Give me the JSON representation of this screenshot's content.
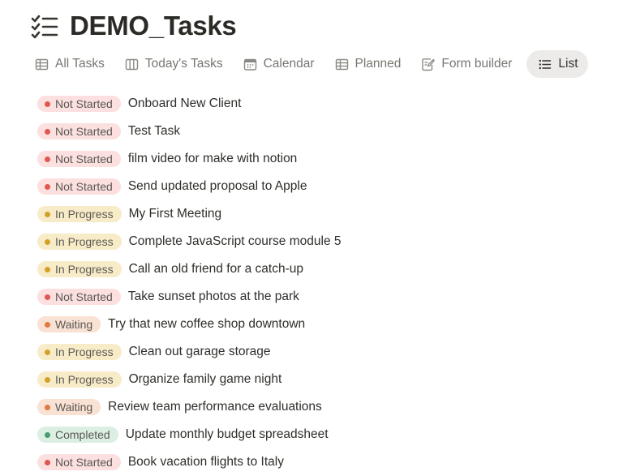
{
  "header": {
    "title": "DEMO_Tasks",
    "icon": "checklist-icon"
  },
  "tabs": [
    {
      "label": "All Tasks",
      "icon": "table-icon",
      "active": false
    },
    {
      "label": "Today's Tasks",
      "icon": "board-icon",
      "active": false
    },
    {
      "label": "Calendar",
      "icon": "calendar-icon",
      "active": false
    },
    {
      "label": "Planned",
      "icon": "table-icon",
      "active": false
    },
    {
      "label": "Form builder",
      "icon": "form-icon",
      "active": false
    },
    {
      "label": "List",
      "icon": "list-icon",
      "active": true
    }
  ],
  "statuses": {
    "not_started": {
      "label": "Not Started",
      "bg": "#fbe0df",
      "dot": "#e0574f"
    },
    "in_progress": {
      "label": "In Progress",
      "bg": "#f8ecc8",
      "dot": "#d3a12a"
    },
    "waiting": {
      "label": "Waiting",
      "bg": "#f9e1d3",
      "dot": "#e07a41"
    },
    "completed": {
      "label": "Completed",
      "bg": "#dcefe3",
      "dot": "#4a9b6d"
    }
  },
  "tasks": [
    {
      "status": "Not Started",
      "name": "Onboard New Client"
    },
    {
      "status": "Not Started",
      "name": "Test Task"
    },
    {
      "status": "Not Started",
      "name": "film video for make with notion"
    },
    {
      "status": "Not Started",
      "name": "Send updated proposal to Apple"
    },
    {
      "status": "In Progress",
      "name": "My First Meeting"
    },
    {
      "status": "In Progress",
      "name": "Complete JavaScript course module 5"
    },
    {
      "status": "In Progress",
      "name": "Call an old friend for a catch-up"
    },
    {
      "status": "Not Started",
      "name": "Take sunset photos at the park"
    },
    {
      "status": "Waiting",
      "name": "Try that new coffee shop downtown"
    },
    {
      "status": "In Progress",
      "name": "Clean out garage storage"
    },
    {
      "status": "In Progress",
      "name": "Organize family game night"
    },
    {
      "status": "Waiting",
      "name": "Review team performance evaluations"
    },
    {
      "status": "Completed",
      "name": "Update monthly budget spreadsheet"
    },
    {
      "status": "Not Started",
      "name": "Book vacation flights to Italy"
    }
  ]
}
